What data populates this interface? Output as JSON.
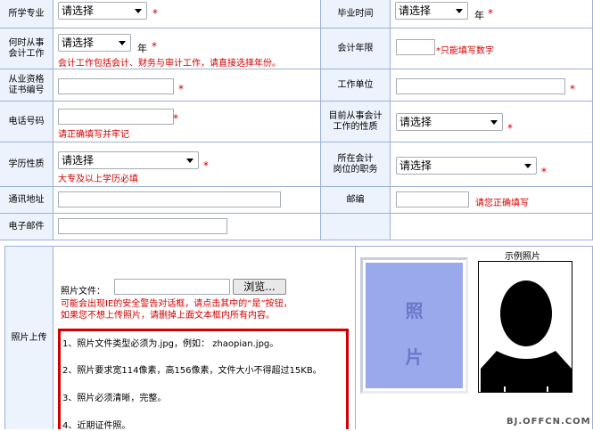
{
  "form": {
    "major_label": "所学专业",
    "major_select": "请选择",
    "grad_label": "毕业时间",
    "grad_select": "请选择",
    "year_unit": "年",
    "when_label": "何时从事\n会计工作",
    "when_select": "请选择",
    "when_note": "会计工作包括会计、财务与审计工作，请直接选择年份。",
    "years_label": "会计年限",
    "years_note": "*只能填写数字",
    "cert_label": "从业资格\n证书编号",
    "employer_label": "工作单位",
    "phone_label": "电话号码",
    "phone_note": "请正确填写并牢记",
    "nature_label": "目前从事会计\n工作的性质",
    "nature_select": "请选择",
    "edu_label": "学历性质",
    "edu_select": "请选择",
    "edu_note": "大专及以上学历必填",
    "position_label": "所在会计\n岗位的职务",
    "position_select": "请选择",
    "address_label": "通讯地址",
    "zip_label": "邮编",
    "zip_note": "请您正确填写",
    "email_label": "电子邮件",
    "star": "*"
  },
  "photo": {
    "label": "照片上传",
    "file_label": "照片文件：",
    "browse_button": "浏览...",
    "warning_1": "可能会出现IE的安全警告对话框，请点击其中的“是”按钮，",
    "warning_2": "如果您不想上传照片，请删掉上面文本框内所有内容。",
    "req_1": "1、照片文件类型必须为.jpg，例如：  zhaopian.jpg。",
    "req_2": "2、照片要求宽114像素，高156像素，文件大小不得超过15KB。",
    "req_3": "3、照片必须清晰，完整。",
    "req_4": "4、近期证件照。",
    "placeholder_1": "照",
    "placeholder_2": "片",
    "sample_title": "示例照片"
  },
  "watermark": "BJ.OFFCN.COM",
  "colors": {
    "label_bg": "#ecf3fd",
    "border": "#9ab1d4",
    "required": "#d00000",
    "photo_placeholder": "#9aa8ec"
  }
}
